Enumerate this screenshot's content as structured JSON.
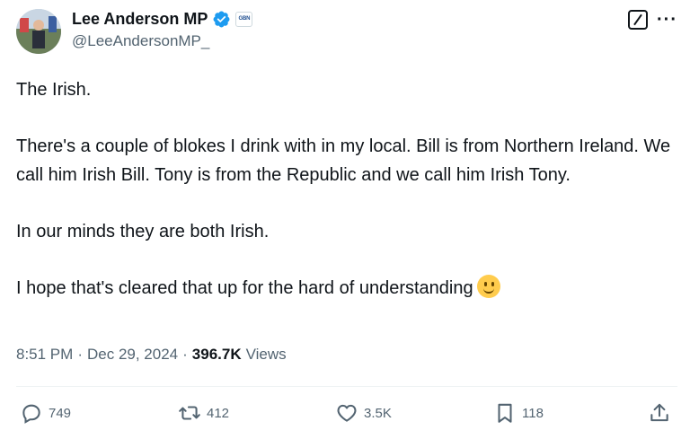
{
  "author": {
    "name": "Lee Anderson MP",
    "handle": "@LeeAndersonMP_",
    "affiliation_badge": "GBN"
  },
  "tweet": {
    "paragraphs": [
      "The Irish.",
      "There's a couple of blokes I drink with in my local. Bill is from Northern Ireland. We call him Irish Bill. Tony is from the Republic and we call him Irish Tony.",
      "In our minds they are both Irish.",
      "I hope that's cleared that up for the hard of understanding"
    ],
    "emoji": "slightly-smiling-face"
  },
  "meta": {
    "time": "8:51 PM",
    "separator": "·",
    "date": "Dec 29, 2024",
    "separator2": "·",
    "views_count": "396.7K",
    "views_label": "Views"
  },
  "actions": {
    "replies": "749",
    "reposts": "412",
    "likes": "3.5K",
    "bookmarks": "118"
  },
  "colors": {
    "verified": "#1d9bf0",
    "text": "#0f1419",
    "secondary": "#536471"
  }
}
